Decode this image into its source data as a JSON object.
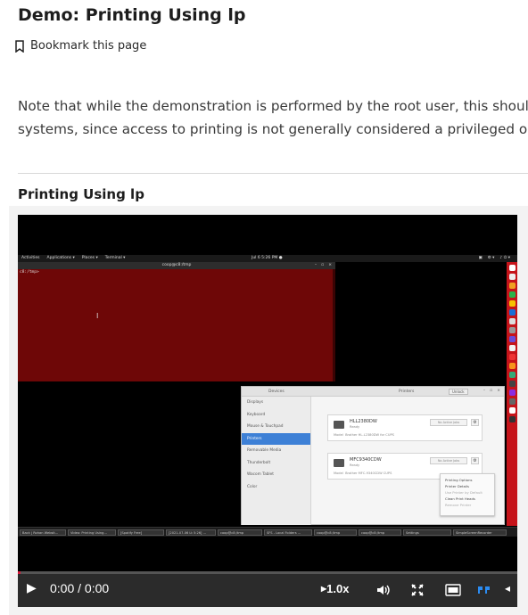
{
  "page": {
    "title": "Demo: Printing Using lp",
    "bookmark_label": "Bookmark this page",
    "note_line1": "Note that while the demonstration is performed by the root user, this shoul",
    "note_line2": "systems, since access to printing is not generally considered a privileged o",
    "section_heading": "Printing Using lp"
  },
  "screen": {
    "topbar": {
      "activities": "Activities",
      "applications": "Applications ▾",
      "places": "Places ▾",
      "terminal": "Terminal ▾",
      "clock": "Jul 6  5:26 PM ●"
    },
    "terminal": {
      "title": "coop@c8:/tmp",
      "prompt": "c8:/tmp>"
    },
    "settings": {
      "left_title": "Devices",
      "center_title": "Printers",
      "unlock_label": "Unlock",
      "sidebar": [
        "Displays",
        "Keyboard",
        "Mouse & Touchpad",
        "Printers",
        "Removable Media",
        "Thunderbolt",
        "Wacom Tablet",
        "Color"
      ],
      "active_item": "Printers",
      "printers": [
        {
          "name": "HLL2380DW",
          "status": "Ready",
          "model_label": "Model",
          "model": "Brother HL-L2380DW for CUPS",
          "jobs": "No Active Jobs"
        },
        {
          "name": "MFC9340CDW",
          "status": "Ready",
          "model_label": "Model",
          "model": "Brother MFC-9340CDW CUPS",
          "jobs": "No Active Jobs"
        }
      ],
      "context_menu": [
        "Printing Options",
        "Printer Details",
        "Use Printer by Default",
        "Clean Print Heads",
        "Remove Printer"
      ]
    },
    "taskbar": [
      "Back | Rohan Websit...",
      "Video: Printing Using...",
      "[Spotify Free]",
      "[2021-07-06 Lt 5:26] ...",
      "coop@c8:/tmp",
      "SFS - Local Folders ...",
      "coop@c8:/tmp",
      "coop@c8:/tmp",
      "Settings",
      "SimpleScreenRecorder"
    ]
  },
  "player": {
    "time": "0:00 / 0:00",
    "speed": "1.0x",
    "progress": 0.0
  },
  "colors": {
    "terminal_bg": "#6e0707",
    "dock_bg": "#c5141a",
    "selection": "#3d80d6",
    "progress_accent": "#d61a3c",
    "cc_active": "#2b8cf2"
  },
  "icons": [
    "bookmark-icon",
    "play-icon",
    "speed-play-icon",
    "volume-icon",
    "fullscreen-icon",
    "transcript-icon",
    "captions-icon",
    "chevron-left-icon"
  ]
}
